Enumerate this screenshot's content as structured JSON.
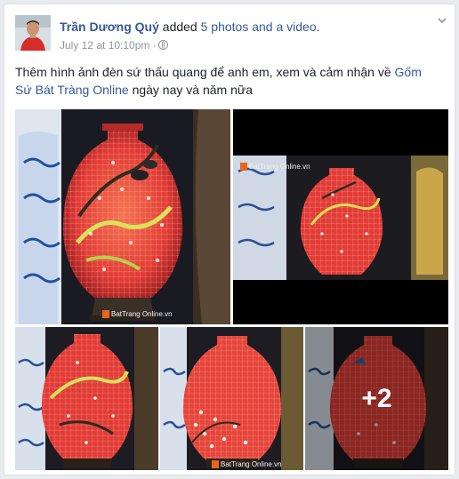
{
  "post": {
    "author": "Trần Dương Quý",
    "action_prefix": "added",
    "action_count": "5 photos and a video",
    "action_suffix": ".",
    "date": "July 12 at 10:10pm",
    "meta_sep": "·",
    "text_before": "Thêm hình ảnh đèn sứ thấu quang để anh em, xem và cảm nhận về",
    "text_link": "Gốm Sứ Bát Tràng Online",
    "text_after": "ngày nay và năm nữa"
  },
  "photos": {
    "watermark": "BatTrang Online.vn",
    "more_count": "+2"
  },
  "colors": {
    "link": "#365899",
    "vase_red": "#e23a35",
    "background": "#e9ebee"
  },
  "icons": {
    "privacy": "globe-icon",
    "options": "chevron-down-icon"
  }
}
